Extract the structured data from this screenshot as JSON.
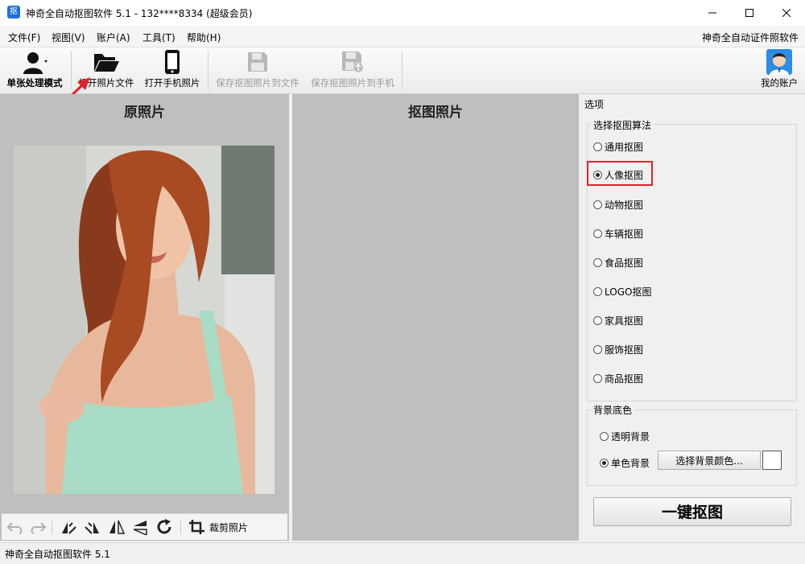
{
  "app": {
    "icon_glyph": "抠",
    "title": "神奇全自动抠图软件 5.1 - 132****8334 (超级会员)",
    "brand_color": "#1e6fd9"
  },
  "window_controls": {
    "minimize": "minimize-icon",
    "maximize": "maximize-icon",
    "close": "close-icon"
  },
  "menu": {
    "items": [
      "文件(F)",
      "视图(V)",
      "账户(A)",
      "工具(T)",
      "帮助(H)"
    ],
    "right_link": "神奇全自动证件照软件"
  },
  "toolbar": {
    "single_mode": "单张处理模式",
    "open_file": "打开照片文件",
    "open_phone": "打开手机照片",
    "save_file": "保存抠图照片到文件",
    "save_phone": "保存抠图照片到手机",
    "account": "我的账户"
  },
  "left": {
    "title": "原照片",
    "crop_label": "裁剪照片"
  },
  "middle": {
    "title": "抠图照片"
  },
  "options": {
    "label": "选项",
    "algo_group": "选择抠图算法",
    "algorithms": [
      "通用抠图",
      "人像抠图",
      "动物抠图",
      "车辆抠图",
      "食品抠图",
      "LOGO抠图",
      "家具抠图",
      "服饰抠图",
      "商品抠图"
    ],
    "selected_algorithm": "人像抠图",
    "highlight_color": "#e0202a",
    "bg_group": "背景底色",
    "bg_transparent": "透明背景",
    "bg_solid": "单色背景",
    "selected_bg": "单色背景",
    "pick_color": "选择背景颜色...",
    "swatch_color": "#ffffff",
    "one_click": "一键抠图"
  },
  "annotation_arrow_color": "#e0202a",
  "status": {
    "text": "神奇全自动抠图软件 5.1"
  }
}
